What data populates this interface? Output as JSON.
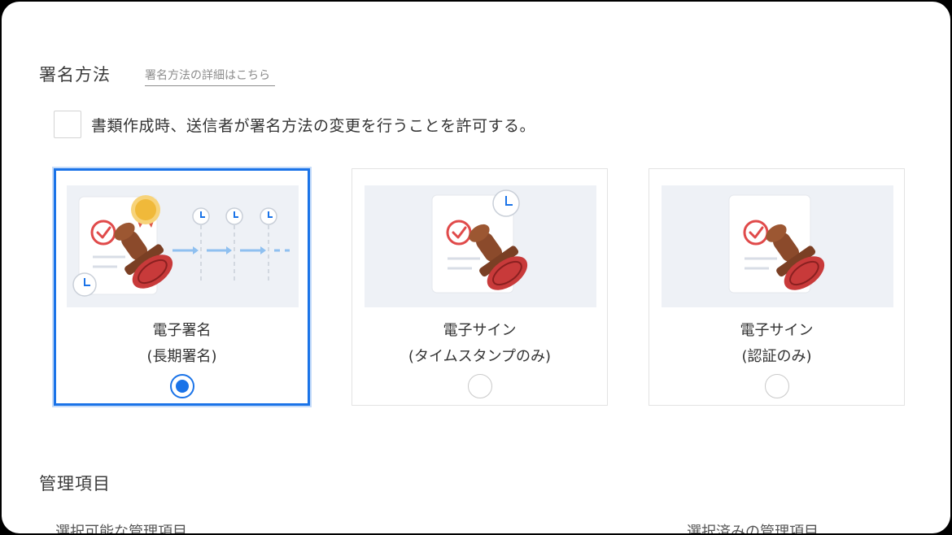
{
  "signature_section": {
    "title": "署名方法",
    "detail_link": "署名方法の詳細はこちら",
    "allow_change_label": "書類作成時、送信者が署名方法の変更を行うことを許可する。",
    "allow_change_checked": false,
    "options": [
      {
        "line1": "電子署名",
        "line2": "(長期署名)",
        "selected": true
      },
      {
        "line1": "電子サイン",
        "line2": "(タイムスタンプのみ)",
        "selected": false
      },
      {
        "line1": "電子サイン",
        "line2": "(認証のみ)",
        "selected": false
      }
    ]
  },
  "management_section": {
    "title": "管理項目",
    "available_label": "選択可能な管理項目",
    "selected_label": "選択済みの管理項目"
  },
  "colors": {
    "accent": "#1a73e8",
    "illustration_bg": "#eef1f6",
    "check_red": "#e04a4a",
    "stamp_brown": "#8b4a2b",
    "medal_gold": "#f0b93a",
    "arrow_blue": "#8fc0f0"
  }
}
